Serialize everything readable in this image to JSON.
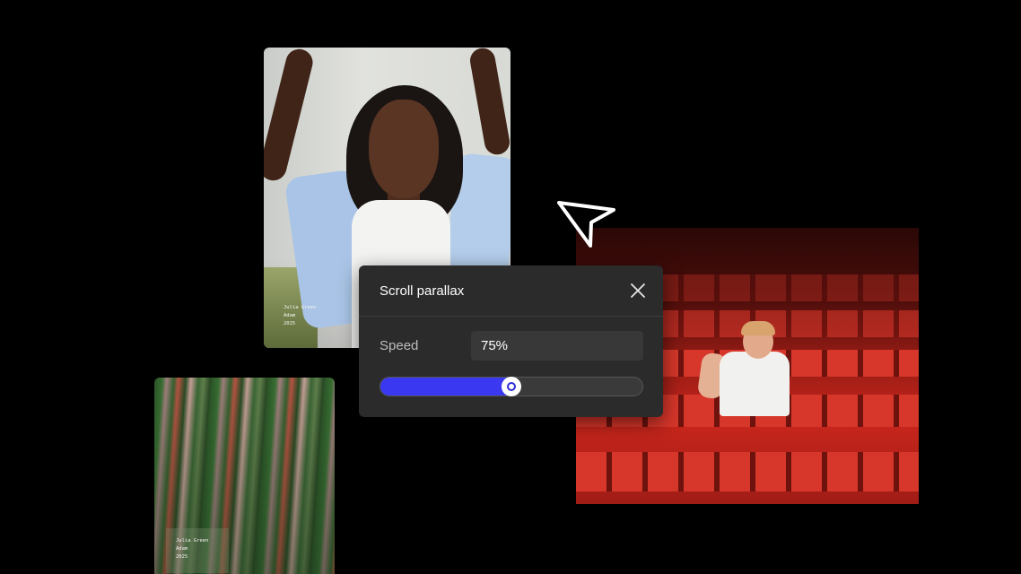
{
  "photos": {
    "portrait": {
      "caption_name": "Julia Green",
      "caption_line2": "Adam",
      "caption_line3": "2025"
    },
    "blur": {
      "caption_name": "Julia Green",
      "caption_line2": "Adam",
      "caption_line3": "2025"
    }
  },
  "dialog": {
    "title": "Scroll parallax",
    "close_icon": "close-icon",
    "speed_label": "Speed",
    "speed_value": "75%",
    "slider_level": 0.5
  },
  "colors": {
    "background": "#000000",
    "panel": "#2b2b2b",
    "slider_fill": "#3a38f0"
  },
  "cursor_icon": "arrow-pointer-icon"
}
